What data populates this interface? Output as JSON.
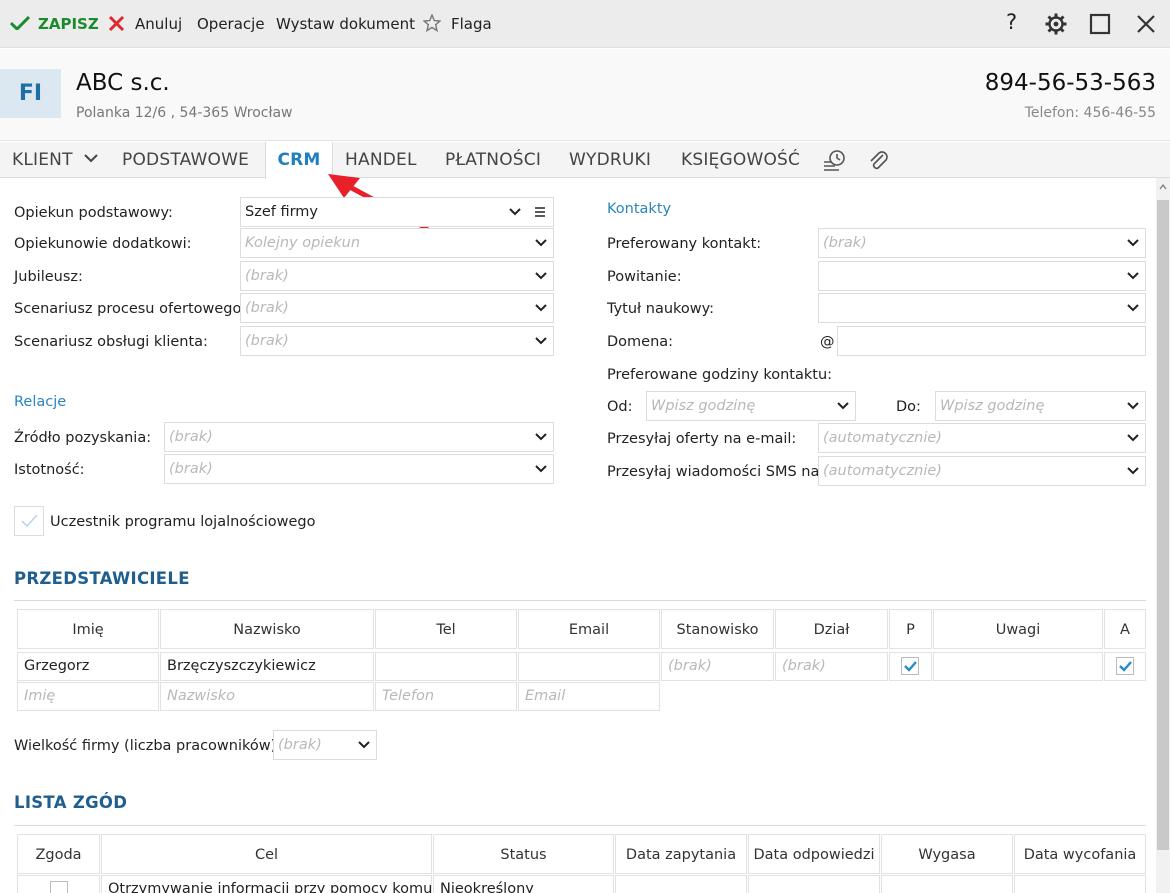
{
  "toolbar": {
    "save_label": "ZAPISZ",
    "cancel_label": "Anuluj",
    "operations_label": "Operacje",
    "issue_document_label": "Wystaw dokument",
    "flag_label": "Flaga",
    "help_label": "?"
  },
  "header": {
    "avatar": "FI",
    "company": "ABC s.c.",
    "address": "Polanka  12/6 , 54-365 Wrocław",
    "nip": "894-56-53-563",
    "phone": "Telefon: 456-46-55"
  },
  "tabs": [
    {
      "label": "KLIENT"
    },
    {
      "label": "PODSTAWOWE"
    },
    {
      "label": "CRM"
    },
    {
      "label": "HANDEL"
    },
    {
      "label": "PŁATNOŚCI"
    },
    {
      "label": "WYDRUKI"
    },
    {
      "label": "KSIĘGOWOŚĆ"
    }
  ],
  "left": {
    "guardian_label": "Opiekun podstawowy:",
    "guardian_value": "Szef firmy",
    "extra_guardians_label": "Opiekunowie dodatkowi:",
    "extra_guardians_placeholder": "Kolejny opiekun",
    "jubilee_label": "Jubileusz:",
    "jubilee_value": "(brak)",
    "offer_scenario_label": "Scenariusz procesu ofertowego:",
    "offer_scenario_value": "(brak)",
    "service_scenario_label": "Scenariusz obsługi klienta:",
    "service_scenario_value": "(brak)",
    "relations_header": "Relacje",
    "source_label": "Źródło pozyskania:",
    "source_value": "(brak)",
    "importance_label": "Istotność:",
    "importance_value": "(brak)",
    "loyalty_label": "Uczestnik programu lojalnościowego"
  },
  "right": {
    "contacts_header": "Kontakty",
    "preferred_contact_label": "Preferowany kontakt:",
    "preferred_contact_value": "(brak)",
    "greeting_label": "Powitanie:",
    "title_label": "Tytuł naukowy:",
    "domain_label": "Domena:",
    "domain_at": "@",
    "hours_label": "Preferowane godziny kontaktu:",
    "from_label": "Od:",
    "from_placeholder": "Wpisz godzinę",
    "to_label": "Do:",
    "to_placeholder": "Wpisz godzinę",
    "send_offers_label": "Przesyłaj oferty na e-mail:",
    "send_offers_value": "(automatycznie)",
    "send_sms_label": "Przesyłaj wiadomości SMS na:",
    "send_sms_value": "(automatycznie)"
  },
  "representatives": {
    "header": "PRZEDSTAWICIELE",
    "columns": [
      "Imię",
      "Nazwisko",
      "Tel",
      "Email",
      "Stanowisko",
      "Dział",
      "P",
      "Uwagi",
      "A"
    ],
    "row": {
      "first": "Grzegorz",
      "last": "Brzęczyszczykiewicz",
      "position": "(brak)",
      "department": "(brak)"
    },
    "new_row": {
      "first": "Imię",
      "last": "Nazwisko",
      "tel": "Telefon",
      "email": "Email"
    }
  },
  "company_size": {
    "label": "Wielkość firmy (liczba pracowników):",
    "value": "(brak)"
  },
  "consents": {
    "header": "LISTA ZGÓD",
    "columns": [
      "Zgoda",
      "Cel",
      "Status",
      "Data zapytania",
      "Data odpowiedzi",
      "Wygasa",
      "Data wycofania"
    ],
    "row": {
      "purpose": "Otrzymywanie informacji przy pomocy komu",
      "status": "Nieokreślony"
    }
  }
}
